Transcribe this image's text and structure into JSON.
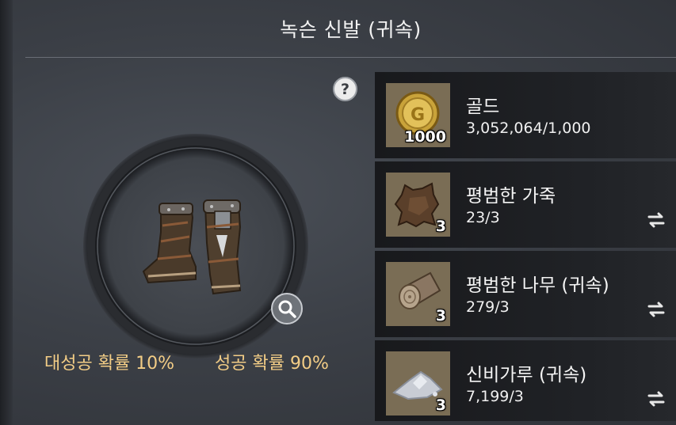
{
  "title": "녹슨 신발 (귀속)",
  "help": {
    "icon": "question-mark-icon",
    "label": "?"
  },
  "item": {
    "icon": "rusty-boots-icon"
  },
  "magnify": {
    "icon": "magnifier-icon"
  },
  "rates": {
    "great_success": "대성공 확률 10%",
    "success": "성공 확률 90%",
    "color": "#f3cd86"
  },
  "materials": [
    {
      "name": "골드",
      "count": "3,052,064/1,000",
      "qty": "1000",
      "icon": "gold-coin-icon",
      "swappable": false
    },
    {
      "name": "평범한 가죽",
      "count": "23/3",
      "qty": "3",
      "icon": "leather-hide-icon",
      "swappable": true
    },
    {
      "name": "평범한 나무 (귀속)",
      "count": "279/3",
      "qty": "3",
      "icon": "wood-log-icon",
      "swappable": true
    },
    {
      "name": "신비가루 (귀속)",
      "count": "7,199/3",
      "qty": "3",
      "icon": "mystic-powder-icon",
      "swappable": true
    }
  ]
}
